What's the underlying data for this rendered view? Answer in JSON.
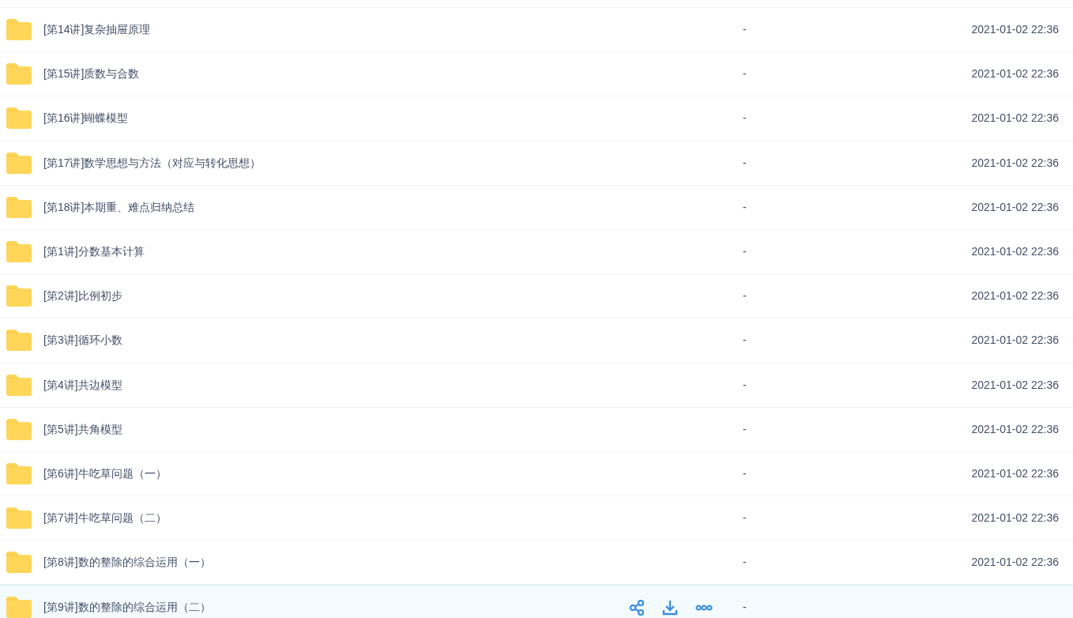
{
  "files": [
    {
      "name": "[第14讲]复杂抽屉原理",
      "size": "-",
      "date": "2021-01-02 22:36",
      "hovered": false
    },
    {
      "name": "[第15讲]质数与合数",
      "size": "-",
      "date": "2021-01-02 22:36",
      "hovered": false
    },
    {
      "name": "[第16讲]蝴蝶模型",
      "size": "-",
      "date": "2021-01-02 22:36",
      "hovered": false
    },
    {
      "name": "[第17讲]数学思想与方法（对应与转化思想）",
      "size": "-",
      "date": "2021-01-02 22:36",
      "hovered": false
    },
    {
      "name": "[第18讲]本期重、难点归纳总结",
      "size": "-",
      "date": "2021-01-02 22:36",
      "hovered": false
    },
    {
      "name": "[第1讲]分数基本计算",
      "size": "-",
      "date": "2021-01-02 22:36",
      "hovered": false
    },
    {
      "name": "[第2讲]比例初步",
      "size": "-",
      "date": "2021-01-02 22:36",
      "hovered": false
    },
    {
      "name": "[第3讲]循环小数",
      "size": "-",
      "date": "2021-01-02 22:36",
      "hovered": false
    },
    {
      "name": "[第4讲]共边模型",
      "size": "-",
      "date": "2021-01-02 22:36",
      "hovered": false
    },
    {
      "name": "[第5讲]共角模型",
      "size": "-",
      "date": "2021-01-02 22:36",
      "hovered": false
    },
    {
      "name": "[第6讲]牛吃草问题（一）",
      "size": "-",
      "date": "2021-01-02 22:36",
      "hovered": false
    },
    {
      "name": "[第7讲]牛吃草问题（二）",
      "size": "-",
      "date": "2021-01-02 22:36",
      "hovered": false
    },
    {
      "name": "[第8讲]数的整除的综合运用（一）",
      "size": "-",
      "date": "2021-01-02 22:36",
      "hovered": false
    },
    {
      "name": "[第9讲]数的整除的综合运用（二）",
      "size": "-",
      "hovered": true
    }
  ]
}
